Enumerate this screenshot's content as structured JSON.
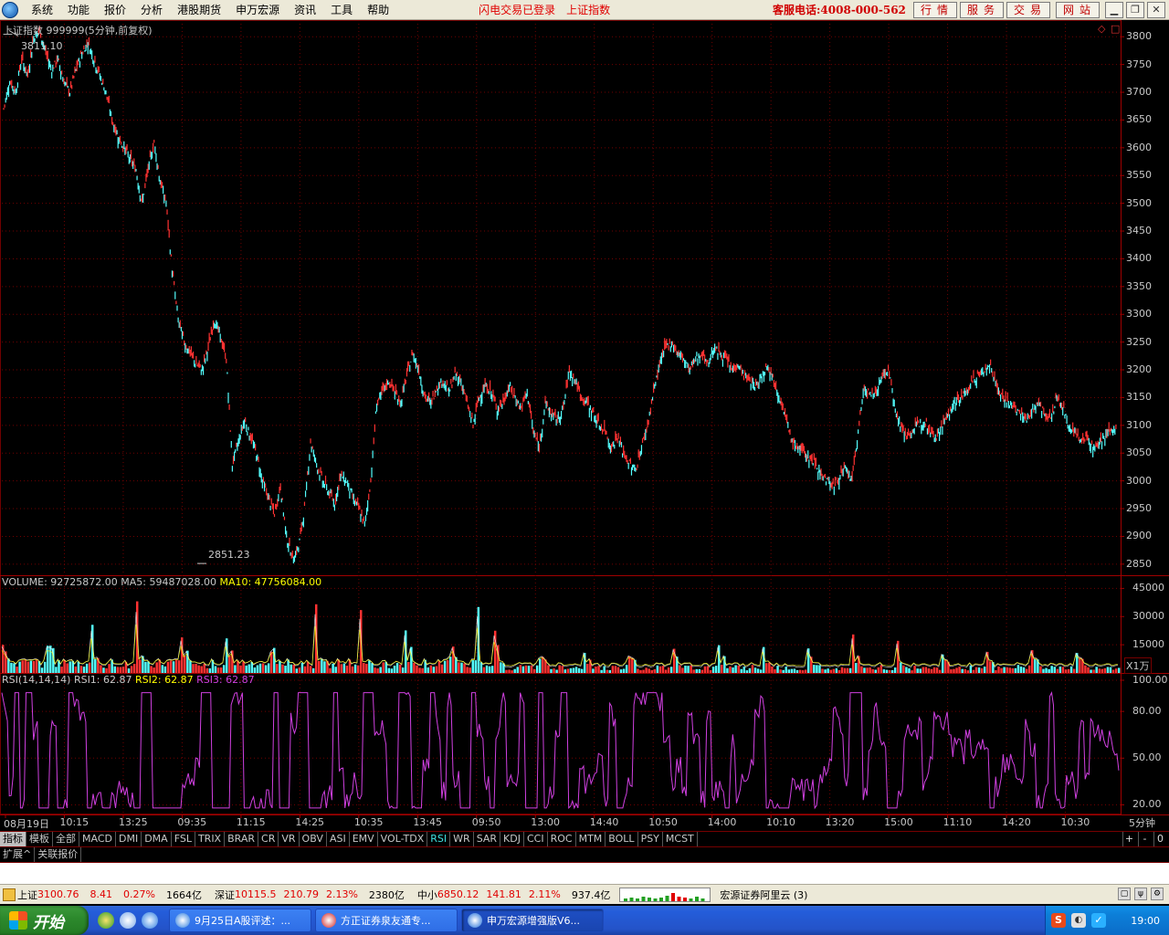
{
  "menubar": {
    "items": [
      "系统",
      "功能",
      "报价",
      "分析",
      "港股期货",
      "申万宏源",
      "资讯",
      "工具",
      "帮助"
    ],
    "status_login": "闪电交易已登录",
    "status_index": "上证指数",
    "hotline": "客服电话:4008-000-562",
    "quick_buttons": [
      "行情",
      "服务",
      "交易",
      "网站"
    ]
  },
  "price_panel": {
    "title": "上证指数 999999(5分钟,前复权)",
    "high_label": "3811.10",
    "low_label": "2851.23",
    "y_ticks": [
      "3800",
      "3750",
      "3700",
      "3650",
      "3600",
      "3550",
      "3500",
      "3450",
      "3400",
      "3350",
      "3300",
      "3250",
      "3200",
      "3150",
      "3100",
      "3050",
      "3000",
      "2950",
      "2900",
      "2850"
    ],
    "corner_icon": "diamond-icon"
  },
  "volume_panel": {
    "label": "VOLUME: 92725872.00",
    "ma5_label": "MA5: 59487028.00",
    "ma10_label": "MA10: 47756084.00",
    "y_ticks": [
      "45000",
      "30000",
      "15000"
    ],
    "unit": "X1万"
  },
  "rsi_panel": {
    "label": "RSI(14,14,14)",
    "rsi1_label": "RSI1: 62.87",
    "rsi2_label": "RSI2: 62.87",
    "rsi3_label": "RSI3: 62.87",
    "y_ticks": [
      "100.00",
      "80.00",
      "50.00",
      "20.00"
    ]
  },
  "time_axis": {
    "labels": [
      "08月19日",
      "10:15",
      "13:25",
      "09:35",
      "11:15",
      "14:25",
      "10:35",
      "13:45",
      "09:50",
      "13:00",
      "14:40",
      "10:50",
      "14:00",
      "10:10",
      "13:20",
      "15:00",
      "11:10",
      "14:20",
      "10:30"
    ],
    "period": "5分钟"
  },
  "indicator_tabs": [
    "指标",
    "模板",
    "全部",
    "MACD",
    "DMI",
    "DMA",
    "FSL",
    "TRIX",
    "BRAR",
    "CR",
    "VR",
    "OBV",
    "ASI",
    "EMV",
    "VOL-TDX",
    "RSI",
    "WR",
    "SAR",
    "KDJ",
    "CCI",
    "ROC",
    "MTM",
    "BOLL",
    "PSY",
    "MCST"
  ],
  "active_indicator": "RSI",
  "zoom_buttons": [
    "+",
    "-",
    "0"
  ],
  "sub_tabs": [
    "扩展^",
    "关联报价"
  ],
  "statusbar": {
    "sh_label": "上证",
    "sh_value": "3100.76",
    "sh_change": "8.41",
    "sh_pct": "0.27%",
    "sh_amount": "1664亿",
    "sz_label": "深证",
    "sz_value": "10115.5",
    "sz_change": "210.79",
    "sz_pct": "2.13%",
    "sz_amount": "2380亿",
    "zx_label": "中小",
    "zx_value": "6850.12",
    "zx_change": "141.81",
    "zx_pct": "2.11%",
    "zx_amount": "937.4亿",
    "broker": "宏源证券阿里云 (3)"
  },
  "taskbar": {
    "start": "开始",
    "tasks": [
      "9月25日A股评述：...",
      "方正证券泉友通专...",
      "申万宏源增强版V6..."
    ],
    "clock": "19:00"
  },
  "colors": {
    "up": "#ff3232",
    "down": "#54ffff",
    "ma5": "#ffffff",
    "ma10": "#ffff00",
    "rsi": "#d040e0",
    "grid": "#700000"
  },
  "chart_data": [
    {
      "type": "line",
      "name_text": "上证指数 999999(5分钟,前复权)",
      "x_labels": [
        "08月19日",
        "10:15",
        "13:25",
        "09:35",
        "11:15",
        "14:25",
        "10:35",
        "13:45",
        "09:50",
        "13:00",
        "14:40",
        "10:50",
        "14:00",
        "10:10",
        "13:20",
        "15:00",
        "11:10",
        "14:20",
        "10:30"
      ],
      "ylim": [
        2830,
        3830
      ],
      "high": 3811.1,
      "low": 2851.23,
      "series": [
        {
          "values": [
            3670,
            3720,
            3700,
            3760,
            3730,
            3800,
            3811,
            3770,
            3740,
            3760,
            3720,
            3700,
            3740,
            3770,
            3790,
            3760,
            3730,
            3700,
            3650,
            3620,
            3600,
            3580,
            3560,
            3500,
            3560,
            3610,
            3540,
            3500,
            3380,
            3290,
            3250,
            3230,
            3210,
            3200,
            3240,
            3290,
            3260,
            3220,
            3030,
            3070,
            3110,
            3080,
            3050,
            3000,
            2970,
            2940,
            2990,
            2900,
            2860,
            2880,
            2950,
            3070,
            3030,
            3000,
            2980,
            2960,
            3010,
            3000,
            2970,
            2950,
            2920,
            3000,
            3140,
            3160,
            3180,
            3160,
            3140,
            3190,
            3230,
            3200,
            3150,
            3140,
            3170,
            3180,
            3160,
            3190,
            3180,
            3140,
            3100,
            3150,
            3170,
            3160,
            3130,
            3140,
            3170,
            3150,
            3130,
            3160,
            3090,
            3060,
            3140,
            3120,
            3110,
            3130,
            3200,
            3180,
            3150,
            3140,
            3120,
            3100,
            3090,
            3060,
            3080,
            3050,
            3030,
            3020,
            3060,
            3100,
            3160,
            3210,
            3240,
            3250,
            3230,
            3220,
            3200,
            3220,
            3230,
            3210,
            3240,
            3230,
            3220,
            3200,
            3210,
            3190,
            3180,
            3170,
            3190,
            3210,
            3180,
            3150,
            3110,
            3070,
            3060,
            3050,
            3040,
            3030,
            3010,
            3000,
            2990,
            3010,
            3020,
            3000,
            3090,
            3170,
            3150,
            3160,
            3190,
            3200,
            3140,
            3100,
            3080,
            3090,
            3100,
            3110,
            3090,
            3080,
            3100,
            3120,
            3140,
            3150,
            3160,
            3180,
            3190,
            3200,
            3210,
            3170,
            3150,
            3140,
            3130,
            3120,
            3110,
            3130,
            3140,
            3120,
            3110,
            3150,
            3130,
            3100,
            3090,
            3070,
            3080,
            3060,
            3070,
            3080,
            3090,
            3100
          ]
        }
      ]
    },
    {
      "type": "bar",
      "name_text": "VOLUME",
      "unit": "X1万",
      "ylim": [
        0,
        52000
      ],
      "series": [
        {
          "values": []
        }
      ]
    },
    {
      "type": "line",
      "name_text": "RSI(14,14,14)",
      "ylim": [
        15,
        100
      ],
      "series": [
        {
          "values": []
        }
      ]
    }
  ]
}
